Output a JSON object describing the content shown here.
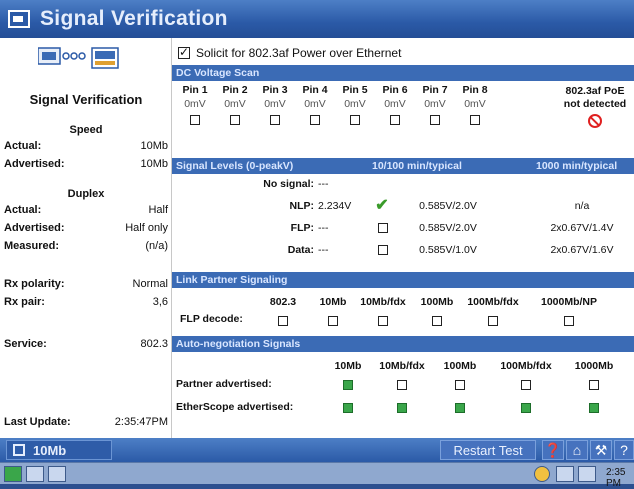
{
  "window": {
    "title": "Signal Verification"
  },
  "left": {
    "heading": "Signal Verification",
    "speed": {
      "title": "Speed",
      "actual_label": "Actual:",
      "actual_value": "10Mb",
      "advertised_label": "Advertised:",
      "advertised_value": "10Mb"
    },
    "duplex": {
      "title": "Duplex",
      "actual_label": "Actual:",
      "actual_value": "Half",
      "advertised_label": "Advertised:",
      "advertised_value": "Half only",
      "measured_label": "Measured:",
      "measured_value": "(n/a)"
    },
    "rx_polarity_label": "Rx polarity:",
    "rx_polarity_value": "Normal",
    "rx_pair_label": "Rx pair:",
    "rx_pair_value": "3,6",
    "service_label": "Service:",
    "service_value": "802.3",
    "last_update_label": "Last Update:",
    "last_update_value": "2:35:47PM"
  },
  "solicit_label": "Solicit for 802.3af Power over Ethernet",
  "dc_scan": {
    "title": "DC Voltage Scan",
    "pins": [
      "Pin 1",
      "Pin 2",
      "Pin 3",
      "Pin 4",
      "Pin 5",
      "Pin 6",
      "Pin 7",
      "Pin 8"
    ],
    "values": [
      "0mV",
      "0mV",
      "0mV",
      "0mV",
      "0mV",
      "0mV",
      "0mV",
      "0mV"
    ],
    "poe_label": "802.3af PoE",
    "poe_status": "not detected"
  },
  "signal_levels": {
    "title": "Signal Levels (0-peakV)",
    "col2": "10/100 min/typical",
    "col3": "1000 min/typical",
    "no_signal_label": "No signal:",
    "no_signal_value": "---",
    "nlp_label": "NLP:",
    "nlp_value": "2.234V",
    "nlp_10_100": "0.585V/2.0V",
    "nlp_1000": "n/a",
    "flp_label": "FLP:",
    "flp_value": "---",
    "flp_10_100": "0.585V/2.0V",
    "flp_1000": "2x0.67V/1.4V",
    "data_label": "Data:",
    "data_value": "---",
    "data_10_100": "0.585V/1.0V",
    "data_1000": "2x0.67V/1.6V"
  },
  "link_partner": {
    "title": "Link Partner Signaling",
    "cols": [
      "802.3",
      "10Mb",
      "10Mb/fdx",
      "100Mb",
      "100Mb/fdx",
      "1000Mb/NP"
    ],
    "row_label": "FLP decode:"
  },
  "autoneg": {
    "title": "Auto-negotiation Signals",
    "cols": [
      "10Mb",
      "10Mb/fdx",
      "100Mb",
      "100Mb/fdx",
      "1000Mb"
    ],
    "partner_label": "Partner advertised:",
    "etherscope_label": "EtherScope advertised:"
  },
  "toolbar": {
    "speed_label": "10Mb",
    "restart_label": "Restart Test"
  },
  "taskbar": {
    "time": "2:35 PM"
  },
  "colors": {
    "titlebar": "#2b5aa7",
    "section": "#3b6bb5",
    "check_green": "#3aa64a",
    "alert_red": "#e02020"
  }
}
